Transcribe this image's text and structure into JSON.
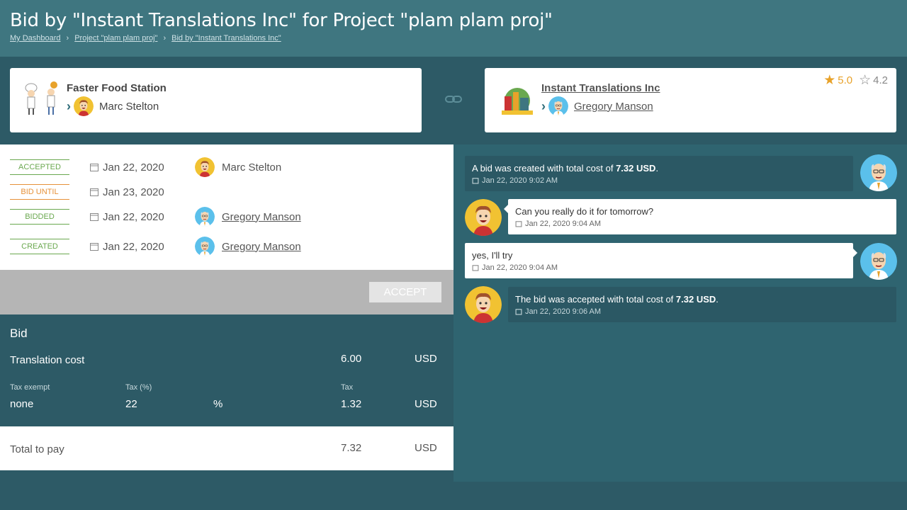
{
  "header": {
    "title": "Bid by \"Instant Translations Inc\" for Project \"plam plam proj\"",
    "breadcrumbs": [
      "My Dashboard",
      "Project \"plam plam proj\"",
      "Bid by \"Instant Translations Inc\""
    ],
    "separator": "›"
  },
  "client": {
    "company": "Faster Food Station",
    "person": "Marc Stelton"
  },
  "vendor": {
    "company": "Instant Translations Inc",
    "person": "Gregory Manson",
    "rating_main": "5.0",
    "rating_secondary": "4.2"
  },
  "statuses": [
    {
      "badge": "ACCEPTED",
      "date": "Jan 22, 2020",
      "person": "Marc Stelton"
    },
    {
      "badge": "BID UNTIL",
      "date": "Jan 23, 2020",
      "person": ""
    },
    {
      "badge": "BIDDED",
      "date": "Jan 22, 2020",
      "person": "Gregory Manson"
    },
    {
      "badge": "CREATED",
      "date": "Jan 22, 2020",
      "person": "Gregory Manson"
    }
  ],
  "accept_label": "ACCEPT",
  "bid": {
    "title": "Bid",
    "translation_cost_label": "Translation cost",
    "translation_cost": "6.00",
    "currency": "USD",
    "tax_exempt_label": "Tax exempt",
    "tax_exempt": "none",
    "tax_percent_label": "Tax (%)",
    "tax_percent": "22",
    "percent_sign": "%",
    "tax_label": "Tax",
    "tax": "1.32",
    "total_label": "Total to pay",
    "total": "7.32"
  },
  "messages": [
    {
      "text_pre": "A bid was created with total cost of ",
      "text_bold": "7.32 USD",
      "text_post": ".",
      "time": "Jan 22, 2020 9:02 AM"
    },
    {
      "text": "Can you really do it for tomorrow?",
      "time": "Jan 22, 2020 9:04 AM"
    },
    {
      "text": "yes, I'll try",
      "time": "Jan 22, 2020 9:04 AM"
    },
    {
      "text_pre": "The bid was accepted with total cost of ",
      "text_bold": "7.32 USD",
      "text_post": ".",
      "time": "Jan 22, 2020 9:06 AM"
    }
  ],
  "colors": {
    "header_bg": "#3f7680",
    "page_bg": "#2d5a66",
    "accent_orange": "#e8a22a",
    "badge_green": "#6aa84f",
    "badge_orange": "#e69138"
  }
}
